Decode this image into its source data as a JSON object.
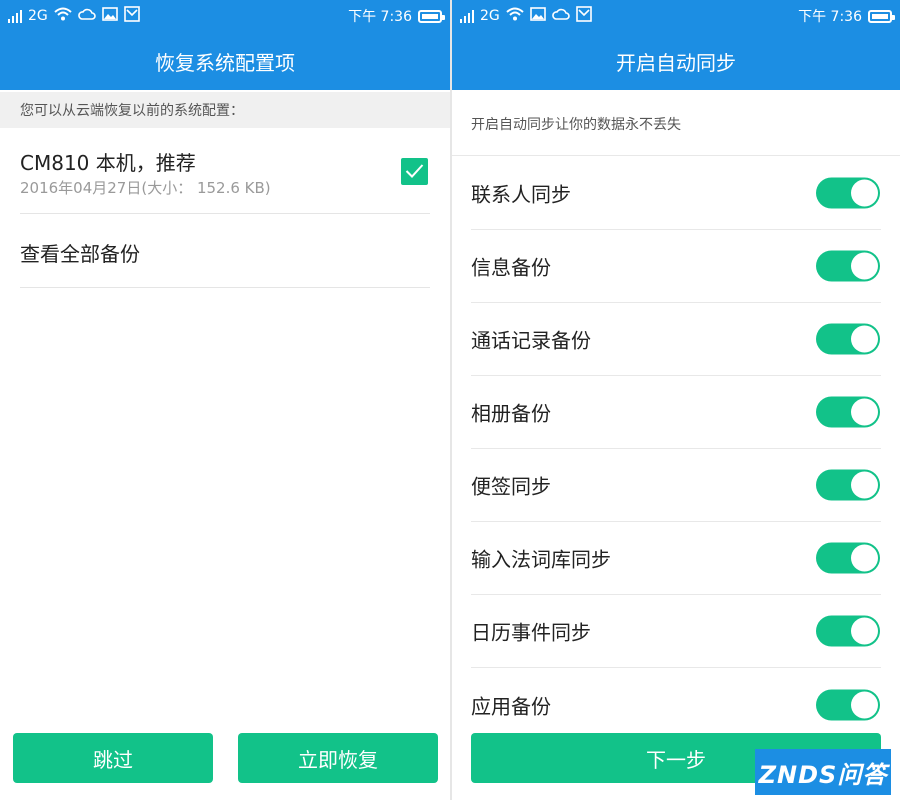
{
  "status_bar": {
    "network": "2G",
    "time": "下午 7:36",
    "icons": [
      "signal-icon",
      "wifi-icon",
      "cloud-icon",
      "image-icon",
      "mail-icon",
      "battery-icon"
    ]
  },
  "left_screen": {
    "title": "恢复系统配置项",
    "hint": "您可以从云端恢复以前的系统配置：",
    "backup_item": {
      "name": "CM810 本机，推荐",
      "detail": "2016年04月27日(大小： 152.6 KB)",
      "checked": true
    },
    "view_all_label": "查看全部备份",
    "skip_label": "跳过",
    "restore_label": "立即恢复"
  },
  "right_screen": {
    "title": "开启自动同步",
    "hint": "开启自动同步让你的数据永不丢失",
    "sync_items": [
      {
        "label": "联系人同步",
        "enabled": true
      },
      {
        "label": "信息备份",
        "enabled": true
      },
      {
        "label": "通话记录备份",
        "enabled": true
      },
      {
        "label": "相册备份",
        "enabled": true
      },
      {
        "label": "便签同步",
        "enabled": true
      },
      {
        "label": "输入法词库同步",
        "enabled": true
      },
      {
        "label": "日历事件同步",
        "enabled": true
      },
      {
        "label": "应用备份",
        "enabled": true
      }
    ],
    "next_label": "下一步"
  },
  "watermark": "ZNDS问答",
  "colors": {
    "header_blue": "#1c8ee3",
    "accent_green": "#12c289"
  }
}
